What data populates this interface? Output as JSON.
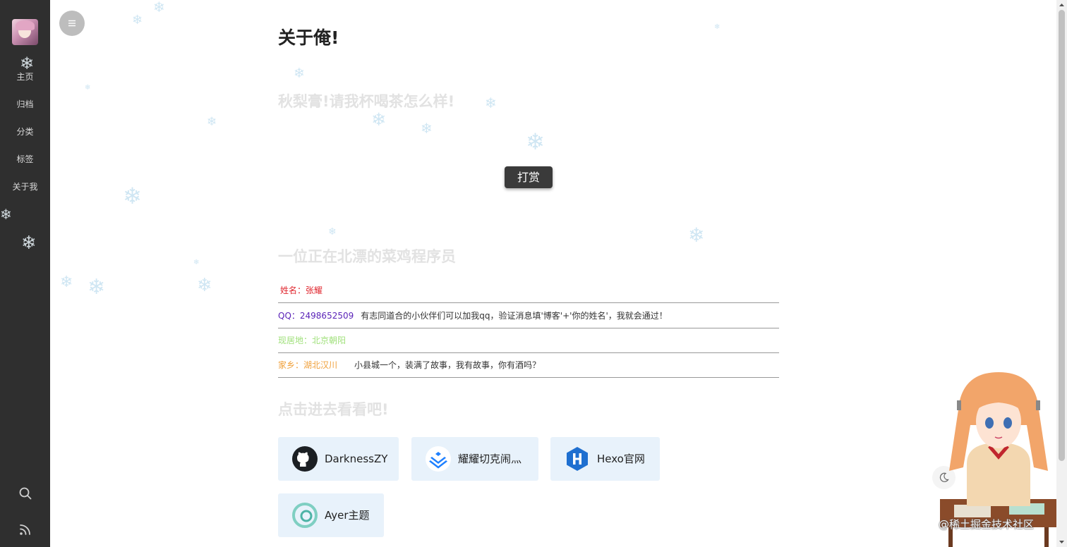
{
  "sidebar": {
    "nav": [
      {
        "label": "主页"
      },
      {
        "label": "归档"
      },
      {
        "label": "分类"
      },
      {
        "label": "标签"
      },
      {
        "label": "关于我"
      }
    ]
  },
  "main": {
    "title": "关于俺!",
    "reward_heading": "秋梨膏!请我杯喝茶怎么样!",
    "reward_button": "打赏",
    "intro_heading": "一位正在北漂的菜鸡程序员",
    "info_rows": [
      {
        "label": "姓名：张耀",
        "desc": "",
        "color": "#e0262e"
      },
      {
        "label": "QQ：2498652509",
        "desc": "有志同道合的小伙伴们可以加我qq，验证消息填'博客'+'你的姓名'，我就会通过！",
        "color": "#5a23b8"
      },
      {
        "label": "现居地：北京朝阳",
        "desc": "",
        "color": "#9fe07a"
      },
      {
        "label": "家乡：湖北汉川",
        "desc": "小县城一个，装满了故事，我有故事，你有酒吗？",
        "color": "#f0a03a"
      }
    ],
    "links_heading": "点击进去看看吧!",
    "links": [
      {
        "label": "DarknessZY",
        "icon": "github-icon"
      },
      {
        "label": "耀耀切克闹灬",
        "icon": "juejin-icon"
      },
      {
        "label": "Hexo官网",
        "icon": "hexo-icon"
      },
      {
        "label": "Ayer主题",
        "icon": "ayer-icon"
      }
    ]
  },
  "watermark": "@稀土掘金技术社区",
  "colors": {
    "sidebar_bg": "#2f2f2f",
    "card_bg": "#e8f2fb",
    "faint_heading": "#e2e2e2"
  }
}
